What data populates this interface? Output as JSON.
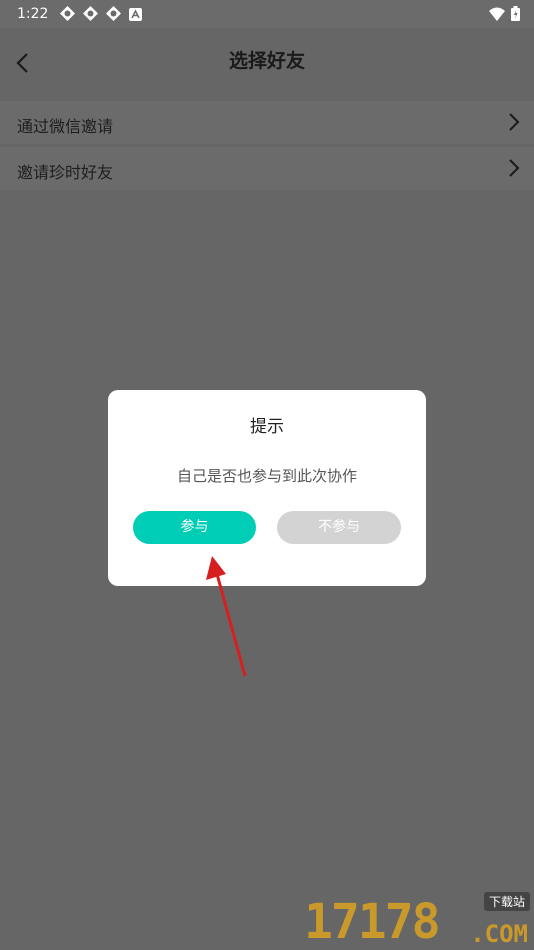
{
  "status_bar": {
    "time": "1:22"
  },
  "header": {
    "title": "选择好友"
  },
  "list": [
    {
      "label": "通过微信邀请"
    },
    {
      "label": "邀请珍时好友"
    }
  ],
  "dialog": {
    "title": "提示",
    "message": "自己是否也参与到此次协作",
    "confirm_label": "参与",
    "cancel_label": "不参与"
  },
  "watermark": {
    "number": "17178",
    "badge": "下载站",
    "domain": ".COM"
  },
  "colors": {
    "accent": "#00cdb5",
    "cancel_button": "#d3d3d3",
    "overlay": "#666666",
    "arrow": "#d62020"
  }
}
